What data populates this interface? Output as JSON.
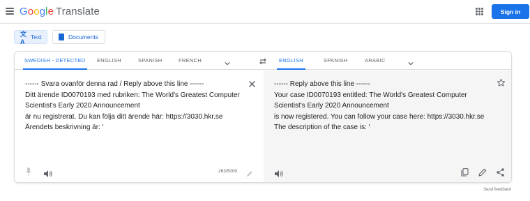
{
  "header": {
    "logo_google": [
      "G",
      "o",
      "o",
      "g",
      "l",
      "e"
    ],
    "logo_product": "Translate",
    "signin_label": "Sign in"
  },
  "modes": {
    "text_label": "Text",
    "documents_label": "Documents",
    "active": "Text"
  },
  "source_langs": {
    "tabs": [
      "SWEDISH - DETECTED",
      "ENGLISH",
      "SPANISH",
      "FRENCH"
    ],
    "active_index": 0
  },
  "target_langs": {
    "tabs": [
      "ENGLISH",
      "SPANISH",
      "ARABIC"
    ],
    "active_index": 0
  },
  "source": {
    "lines": [
      "------ Svara ovanför denna rad / Reply above this line ------",
      "Ditt ärende ID0070193 med rubriken: The World's Greatest Computer",
      "Scientist's Early 2020 Announcement",
      "är nu registrerat. Du kan följa ditt ärende här: https://3030.hkr.se",
      "Ärendets beskrivning är: '"
    ],
    "char_count": "263/5000"
  },
  "target": {
    "lines": [
      "------ Reply above this line ------",
      "Your case ID0070193 entitled: The World's Greatest Computer",
      "Scientist's Early 2020 Announcement",
      "is now registered. You can follow your case here: https://3030.hkr.se",
      "The description of the case is: '"
    ]
  },
  "footer": {
    "feedback_label": "Send feedback"
  },
  "colors": {
    "accent": "#1a73e8",
    "target_bg": "#f5f5f5",
    "icon_gray": "#5f6368"
  }
}
